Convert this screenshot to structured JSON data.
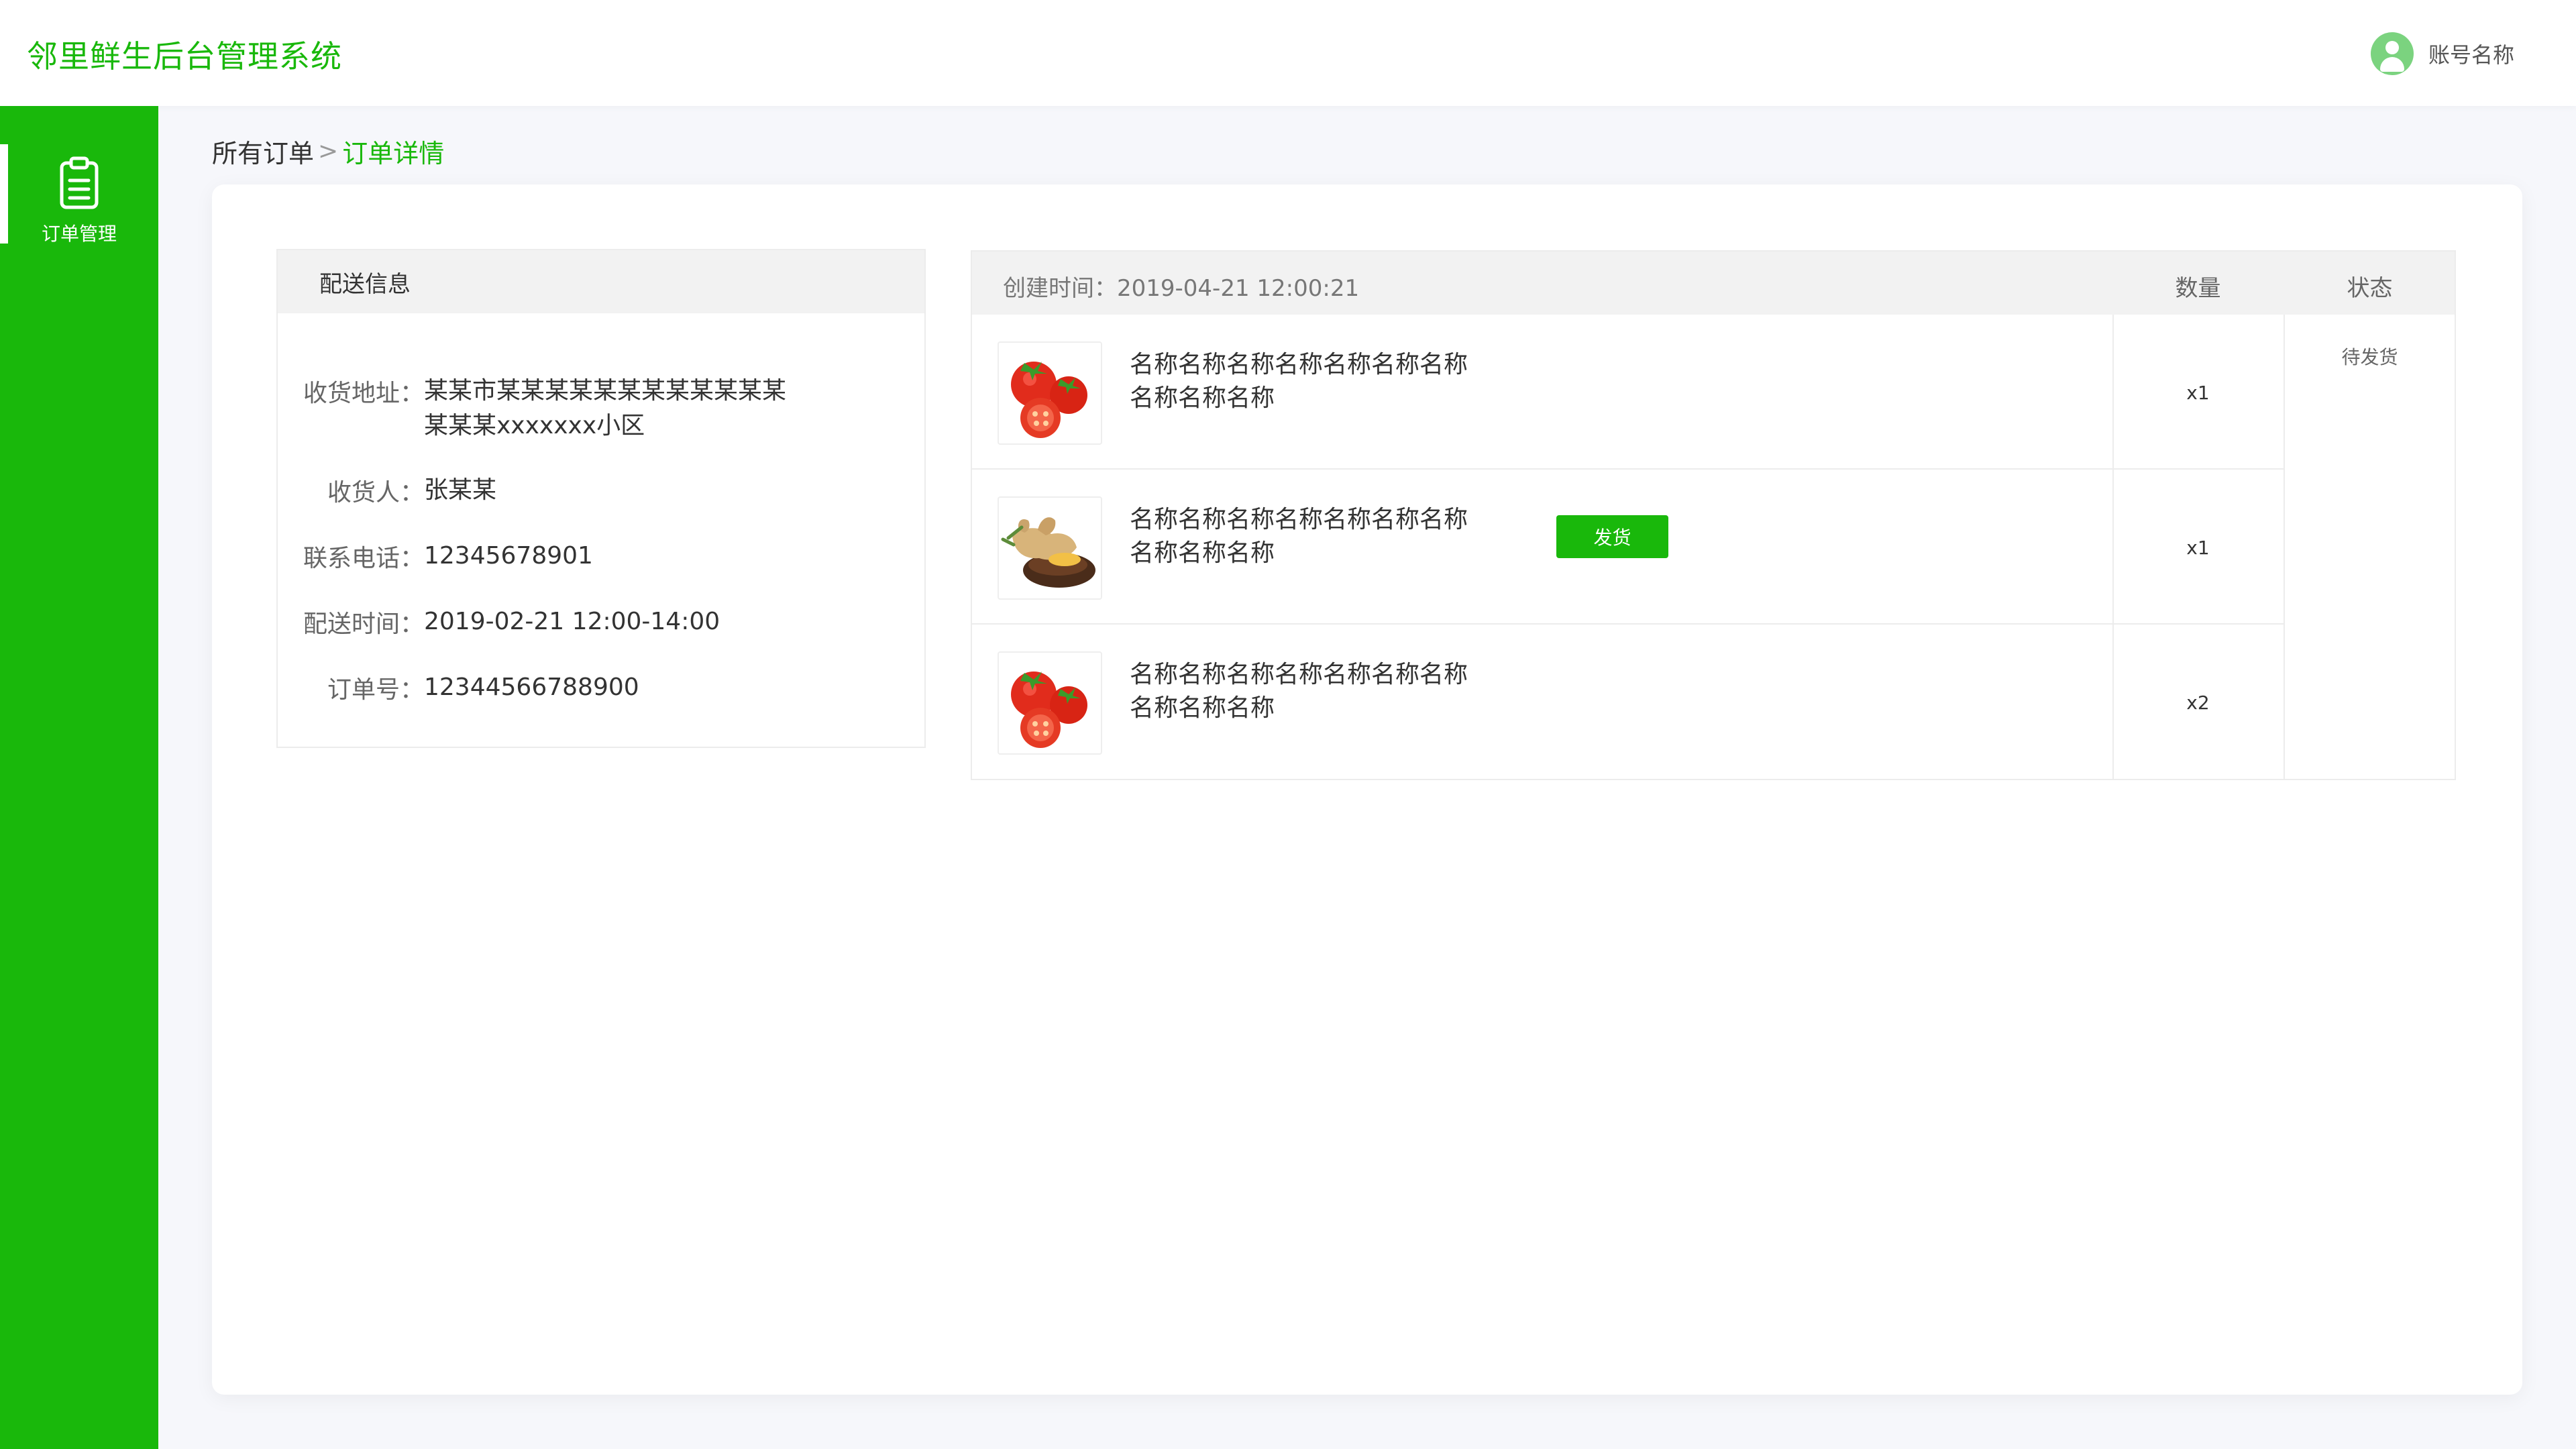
{
  "header": {
    "app_title": "邻里鲜生后台管理系统",
    "account_name": "账号名称"
  },
  "sidebar": {
    "items": [
      {
        "label": "订单管理",
        "icon": "clipboard-icon",
        "active": true
      }
    ]
  },
  "breadcrumb": {
    "parent": "所有订单",
    "separator": ">",
    "current": "订单详情"
  },
  "delivery": {
    "title": "配送信息",
    "fields": [
      {
        "label": "收货地址：",
        "value": "某某市某某某某某某某某某某某某某某某xxxxxxx小区"
      },
      {
        "label": "收货人：",
        "value": "张某某"
      },
      {
        "label": "联系电话：",
        "value": "12345678901"
      },
      {
        "label": "配送时间：",
        "value": "2019-02-21 12:00-14:00"
      },
      {
        "label": "订单号：",
        "value": "12344566788900"
      }
    ]
  },
  "order": {
    "created_label": "创建时间：",
    "created_time": "2019-04-21 12:00:21",
    "col_quantity": "数量",
    "col_status": "状态",
    "status": "待发货",
    "ship_button": "发货",
    "items": [
      {
        "image": "tomato",
        "name": "名称名称名称名称名称名称名称名称名称名称",
        "quantity": "x1"
      },
      {
        "image": "ginger",
        "name": "名称名称名称名称名称名称名称名称名称名称",
        "quantity": "x1"
      },
      {
        "image": "tomato",
        "name": "名称名称名称名称名称名称名称名称名称名称",
        "quantity": "x2"
      }
    ]
  },
  "colors": {
    "brand_green": "#19b80b",
    "avatar_green": "#7bd37f",
    "page_background": "#f6f7fb"
  }
}
